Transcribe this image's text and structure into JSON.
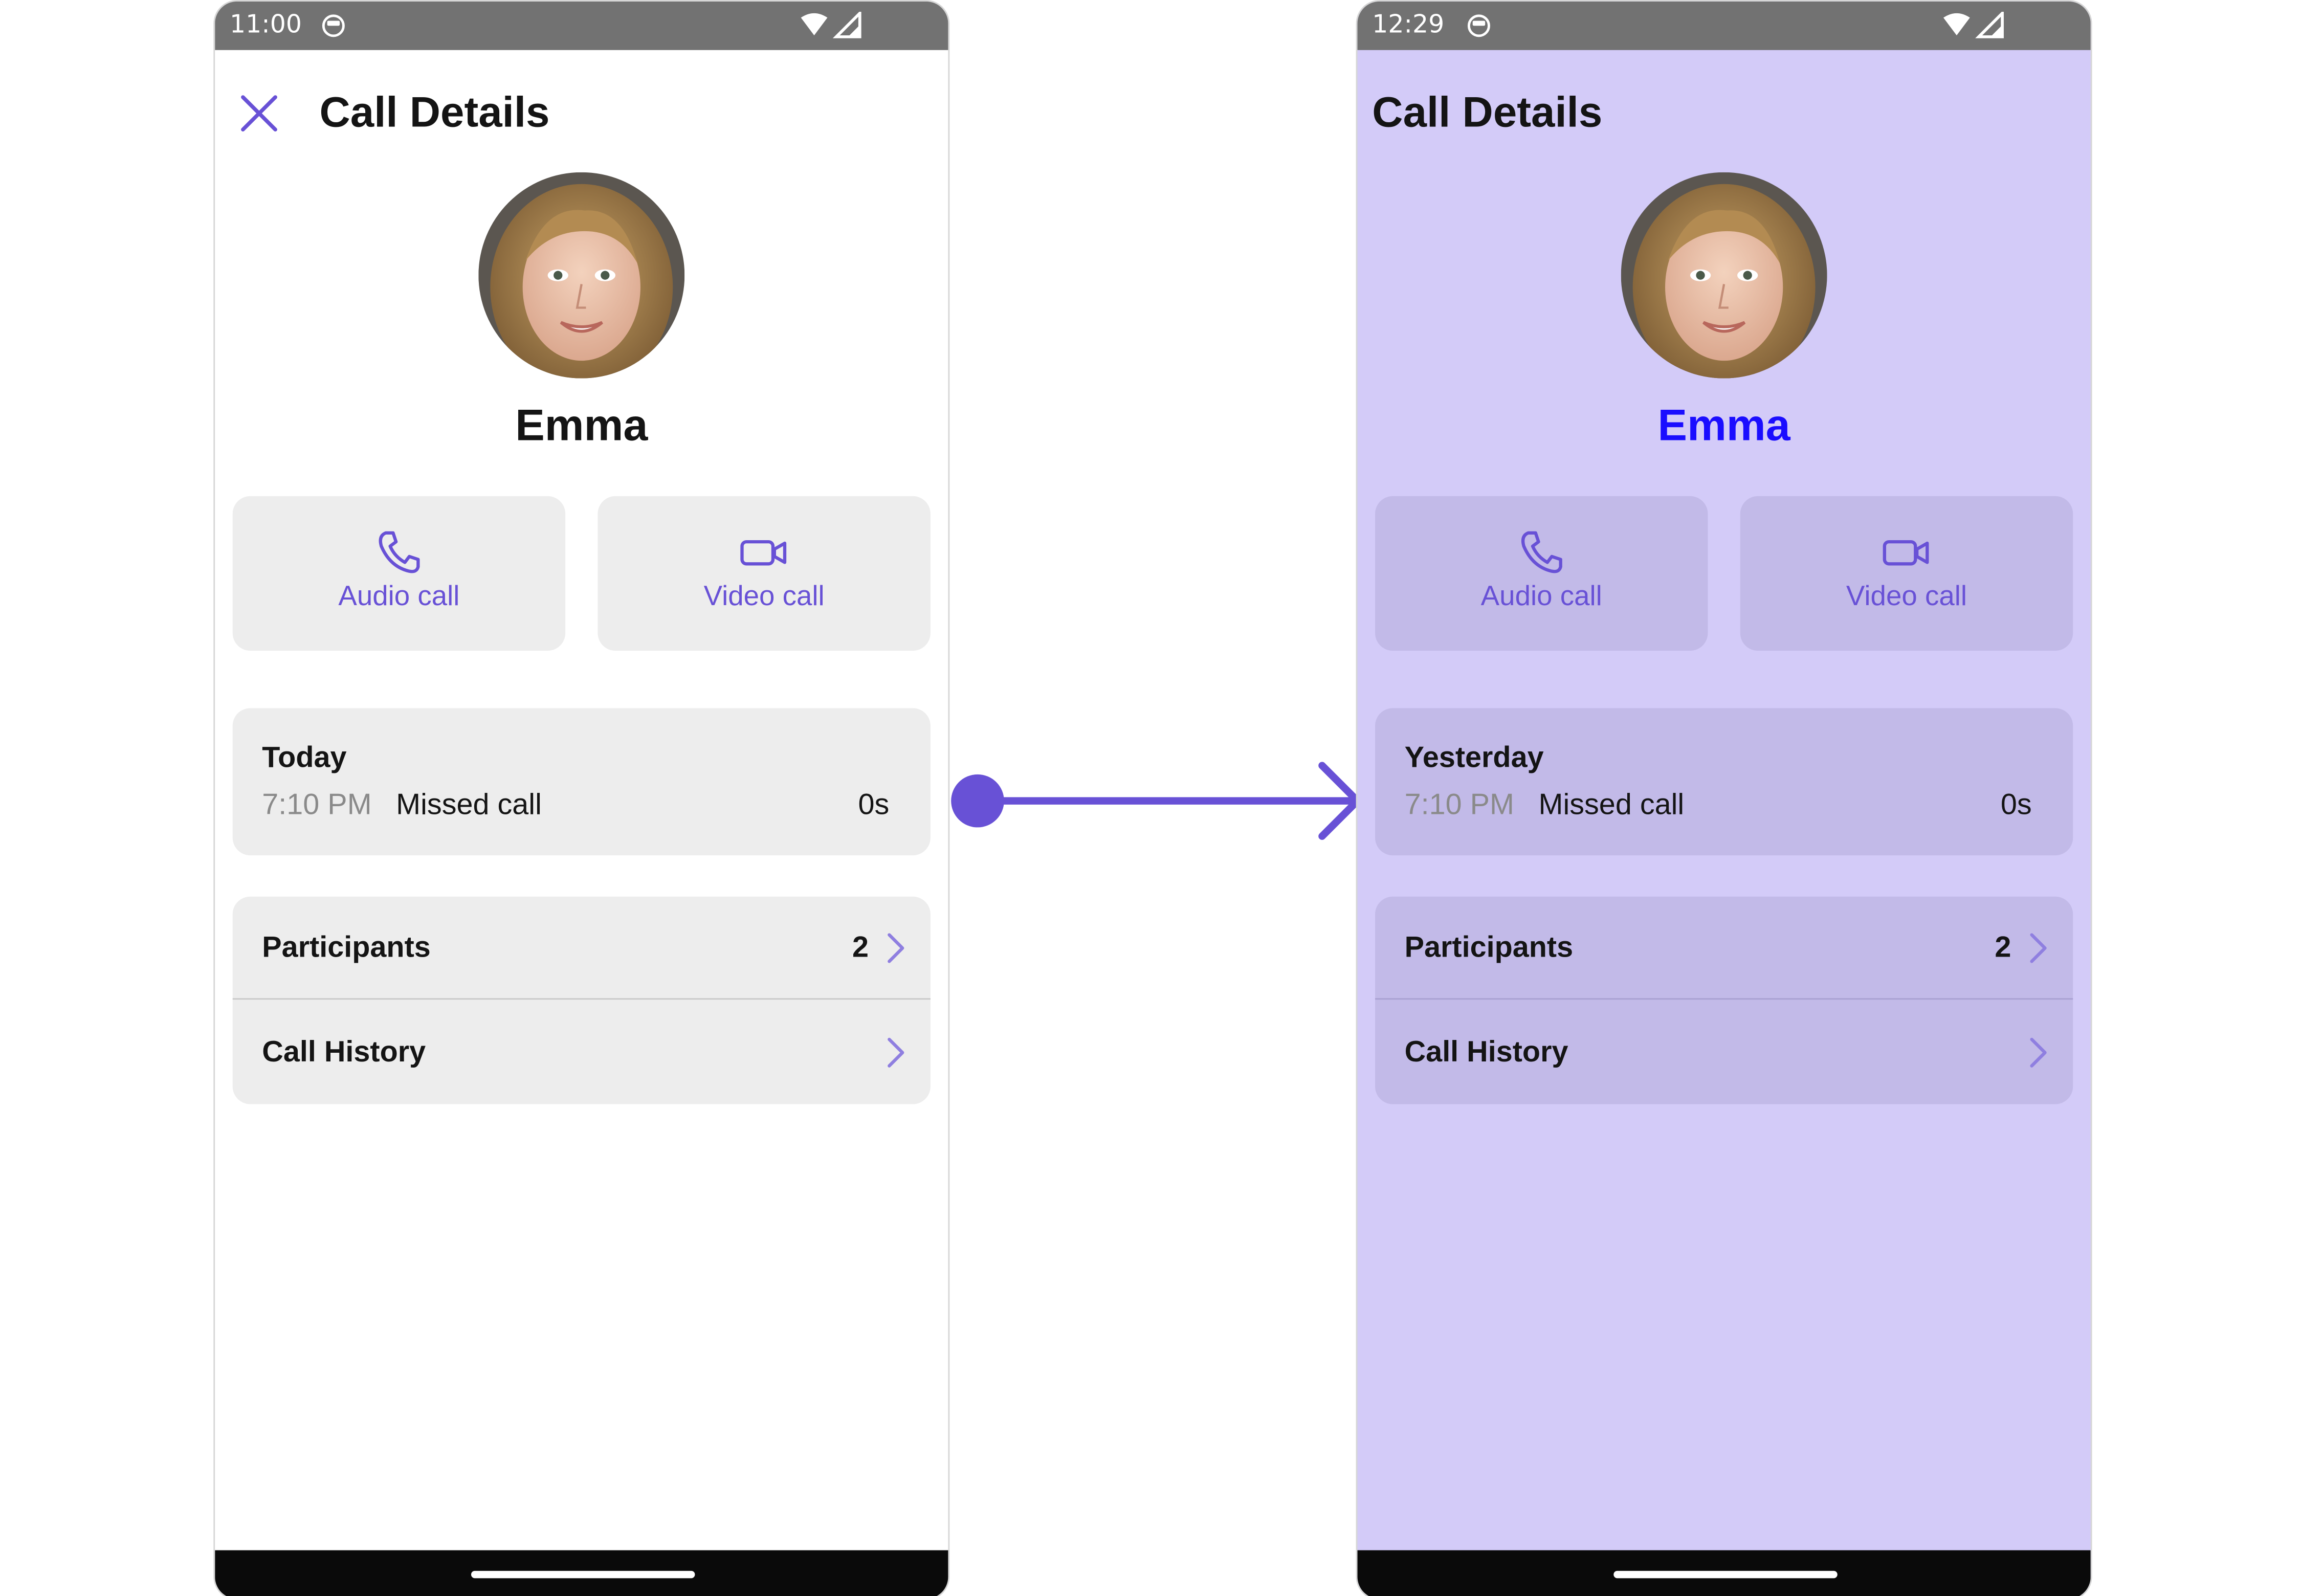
{
  "accent_color": "#6851d6",
  "left_screen": {
    "background": "#ffffff",
    "status_time": "11:00",
    "title": "Call Details",
    "close_icon": "close-icon",
    "name": "Emma",
    "audio_label": "Audio call",
    "video_label": "Video call",
    "history": {
      "day": "Today",
      "time": "7:10 PM",
      "type": "Missed call",
      "duration": "0s"
    },
    "participants_label": "Participants",
    "participants_count": "2",
    "call_history_label": "Call History"
  },
  "right_screen": {
    "background": "#d3cbf8",
    "name_color": "#1a0dff",
    "status_time": "12:29",
    "title": "Call Details",
    "name": "Emma",
    "audio_label": "Audio call",
    "video_label": "Video call",
    "history": {
      "day": "Yesterday",
      "time": "7:10 PM",
      "type": "Missed call",
      "duration": "0s"
    },
    "participants_label": "Participants",
    "participants_count": "2",
    "call_history_label": "Call History"
  }
}
